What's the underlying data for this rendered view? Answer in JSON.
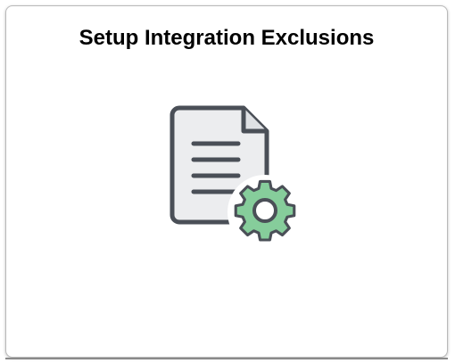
{
  "tile": {
    "title": "Setup Integration Exclusions",
    "icon": "document-gear-icon"
  },
  "colors": {
    "document_fill": "#ecedef",
    "document_stroke": "#4a4f57",
    "gear_fill": "#86cd9b",
    "gear_stroke": "#4a4f57",
    "tile_border": "#b9b9b9"
  }
}
